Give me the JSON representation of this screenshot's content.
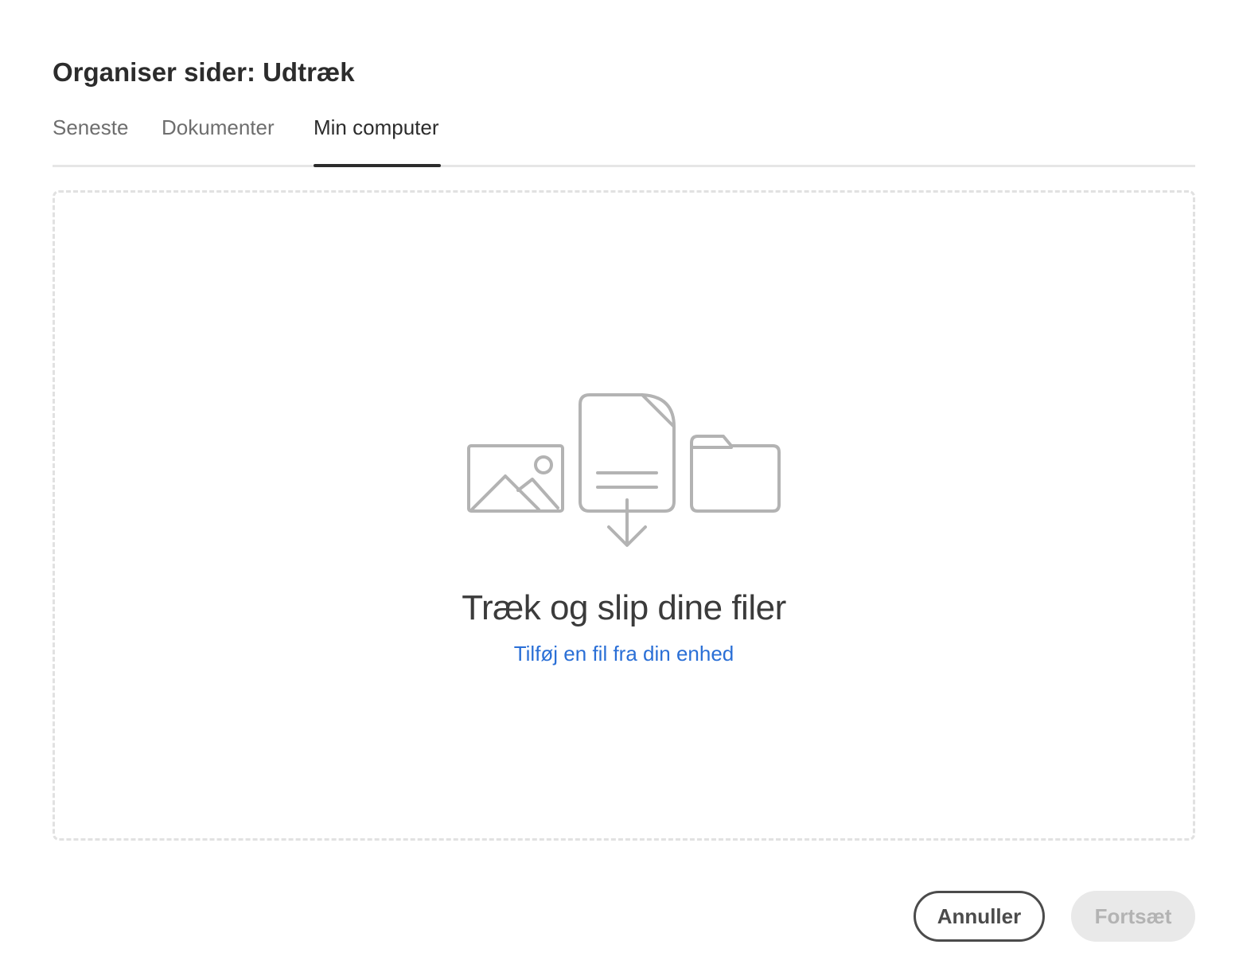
{
  "dialog": {
    "title": "Organiser sider: Udtræk"
  },
  "tabs": [
    {
      "label": "Seneste",
      "active": false
    },
    {
      "label": "Dokumenter",
      "active": false
    },
    {
      "label": "Min computer",
      "active": true
    }
  ],
  "dropzone": {
    "title": "Træk og slip dine filer",
    "link_label": "Tilføj en fil fra din enhed",
    "icons": [
      "image-icon",
      "file-download-icon",
      "folder-icon"
    ],
    "icon_color": "#b3b3b3"
  },
  "footer": {
    "cancel_label": "Annuller",
    "continue_label": "Fortsæt",
    "continue_enabled": false
  },
  "colors": {
    "link": "#2a6fd6",
    "text": "#2c2c2c",
    "tab_inactive": "#6e6e6e",
    "disabled_bg": "#e9e9e9"
  }
}
